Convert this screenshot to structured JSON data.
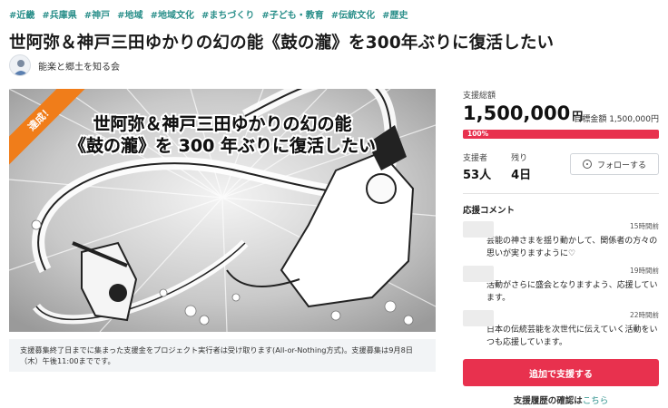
{
  "tags": [
    "#近畿",
    "#兵庫県",
    "#神戸",
    "#地域",
    "#地域文化",
    "#まちづくり",
    "#子ども・教育",
    "#伝統文化",
    "#歴史"
  ],
  "project": {
    "title": "世阿弥＆神戸三田ゆかりの幻の能《鼓の瀧》を300年ぶりに復活したい",
    "owner": "能楽と郷土を知る会"
  },
  "hero": {
    "ribbon": "達成！",
    "line1": "世阿弥＆神戸三田ゆかりの幻の能",
    "line2": "《鼓の瀧》を 300 年ぶりに復活したい"
  },
  "notice": "支援募集終了日までに集まった支援金をプロジェクト実行者は受け取ります(All-or-Nothing方式)。支援募集は9月8日（木）午後11:00までです。",
  "funding": {
    "raised_label": "支援総額",
    "raised": "1,500,000",
    "currency": "円",
    "goal": "目標金額 1,500,000円",
    "percent_label": "100%",
    "percent": 100,
    "backers_label": "支援者",
    "backers": "53人",
    "remaining_label": "残り",
    "remaining": "4日",
    "follow_label": "フォローする"
  },
  "comments": {
    "title": "応援コメント",
    "items": [
      {
        "time": "15時間前",
        "text": "芸能の神さまを揺り動かして、関係者の方々の思いが実りますように♡"
      },
      {
        "time": "19時間前",
        "text": "活動がさらに盛会となりますよう、応援しています。"
      },
      {
        "time": "22時間前",
        "text": "日本の伝統芸能を次世代に伝えていく活動をいつも応援しています。"
      }
    ]
  },
  "cta_label": "追加で支援する",
  "history": {
    "text": "支援履歴の確認は",
    "link": "こちら"
  },
  "colors": {
    "accent": "#e8314e",
    "tag": "#2a8f8a",
    "ribbon": "#f07d1a"
  }
}
